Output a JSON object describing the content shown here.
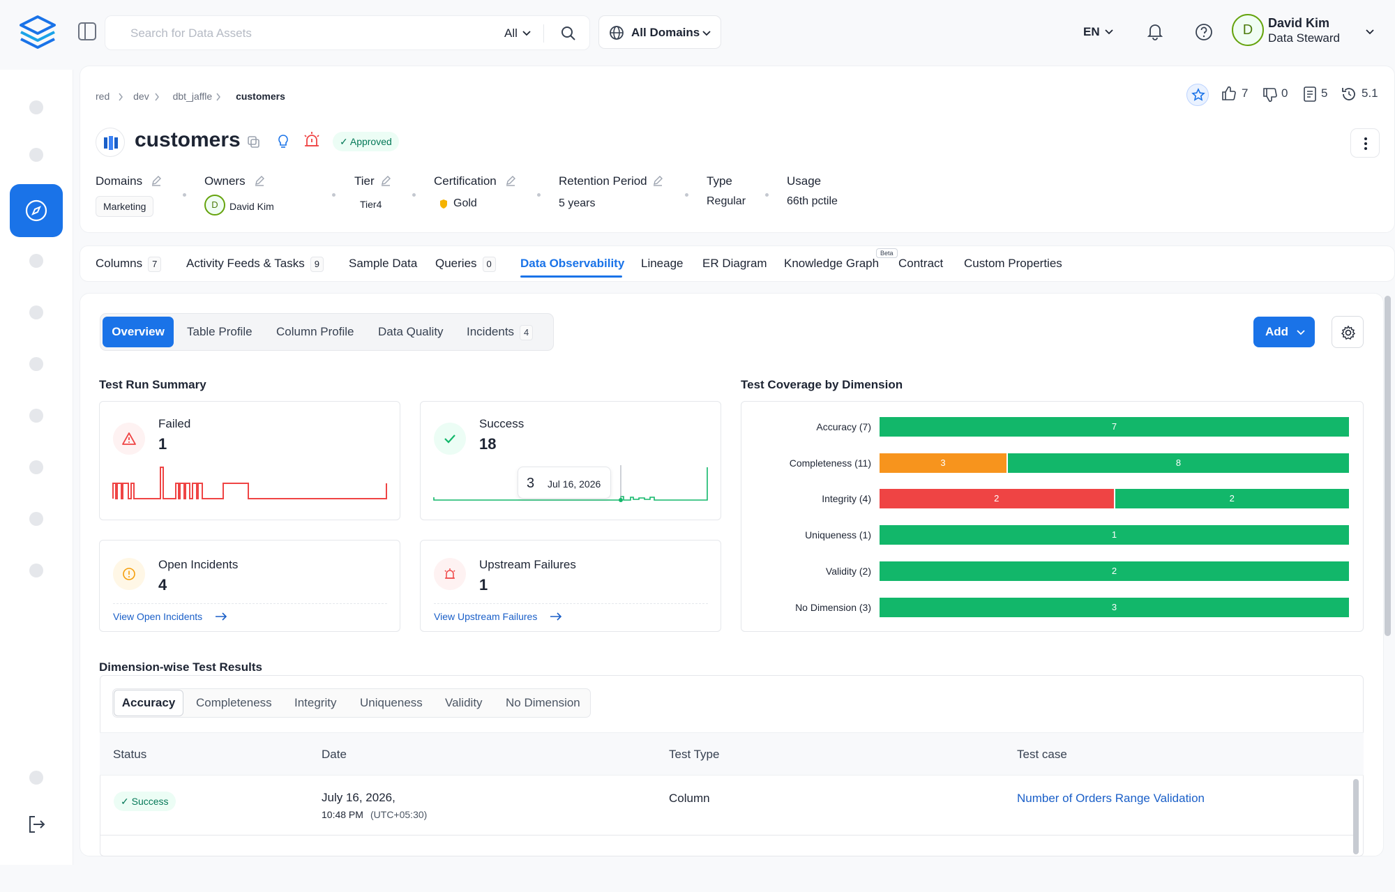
{
  "search": {
    "placeholder": "Search for Data Assets",
    "scope": "All"
  },
  "domains_selector": "All Domains",
  "language": "EN",
  "user": {
    "initial": "D",
    "name": "David Kim",
    "role": "Data Steward"
  },
  "breadcrumb": [
    "red",
    "dev",
    "dbt_jaffle",
    "customers"
  ],
  "entity": {
    "title": "customers",
    "status": "Approved"
  },
  "engagement": {
    "likes": "7",
    "dislikes": "0",
    "tasks": "5",
    "version": "5.1"
  },
  "meta": {
    "domains_label": "Domains",
    "domains_value": "Marketing",
    "owners_label": "Owners",
    "owner_initial": "D",
    "owner_name": "David Kim",
    "tier_label": "Tier",
    "tier_value": "Tier4",
    "cert_label": "Certification",
    "cert_value": "Gold",
    "retention_label": "Retention Period",
    "retention_value": "5 years",
    "type_label": "Type",
    "type_value": "Regular",
    "usage_label": "Usage",
    "usage_value": "66th pctile"
  },
  "tabs": [
    {
      "label": "Columns",
      "count": "7"
    },
    {
      "label": "Activity Feeds & Tasks",
      "count": "9"
    },
    {
      "label": "Sample Data"
    },
    {
      "label": "Queries",
      "count": "0"
    },
    {
      "label": "Data Observability"
    },
    {
      "label": "Lineage"
    },
    {
      "label": "ER Diagram"
    },
    {
      "label": "Knowledge Graph",
      "badge": "Beta"
    },
    {
      "label": "Contract"
    },
    {
      "label": "Custom Properties"
    }
  ],
  "subtabs": [
    {
      "label": "Overview"
    },
    {
      "label": "Table Profile"
    },
    {
      "label": "Column Profile"
    },
    {
      "label": "Data Quality"
    },
    {
      "label": "Incidents",
      "count": "4"
    }
  ],
  "add_button": "Add",
  "test_run_summary": {
    "title": "Test Run Summary",
    "failed": {
      "label": "Failed",
      "value": "1"
    },
    "success": {
      "label": "Success",
      "value": "18",
      "tooltip_value": "3",
      "tooltip_date": "Jul 16, 2026"
    },
    "open_incidents": {
      "label": "Open Incidents",
      "value": "4",
      "link": "View Open Incidents"
    },
    "upstream": {
      "label": "Upstream Failures",
      "value": "1",
      "link": "View Upstream Failures"
    }
  },
  "chart_data": {
    "type": "bar",
    "title": "Test Coverage by Dimension",
    "categories": [
      "Accuracy (7)",
      "Completeness (11)",
      "Integrity (4)",
      "Uniqueness (1)",
      "Validity (2)",
      "No Dimension (3)"
    ],
    "series": [
      {
        "color": "#f7941d",
        "values": [
          0,
          3,
          0,
          0,
          0,
          0
        ]
      },
      {
        "color": "#ef4444",
        "values": [
          0,
          0,
          2,
          0,
          0,
          0
        ]
      },
      {
        "color": "#12b76a",
        "values": [
          7,
          8,
          2,
          1,
          2,
          3
        ]
      }
    ],
    "stacked": true,
    "normalized": true
  },
  "dimension_results": {
    "title": "Dimension-wise Test Results",
    "tabs": [
      "Accuracy",
      "Completeness",
      "Integrity",
      "Uniqueness",
      "Validity",
      "No Dimension"
    ],
    "columns": [
      "Status",
      "Date",
      "Test Type",
      "Test case"
    ],
    "rows": [
      {
        "status": "Success",
        "date": "July 16, 2026,",
        "time": "10:48 PM",
        "tz": "(UTC+05:30)",
        "type": "Column",
        "test_case": "Number of Orders Range Validation"
      }
    ]
  },
  "colors": {
    "accent": "#1a73e8",
    "success": "#12b76a",
    "warning": "#f7941d",
    "danger": "#ef4444"
  }
}
